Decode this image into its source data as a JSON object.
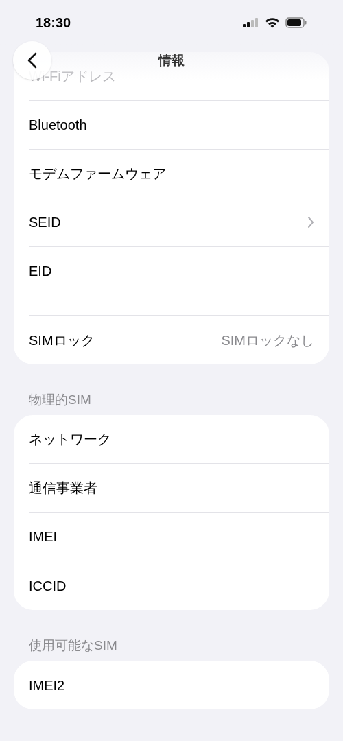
{
  "status_bar": {
    "time": "18:30"
  },
  "nav": {
    "title": "情報"
  },
  "sections": [
    {
      "rows": [
        {
          "kind": "plain",
          "label": "Wi-Fiアドレス",
          "dimmed": true
        },
        {
          "kind": "plain",
          "label": "Bluetooth",
          "dimmed": false
        },
        {
          "kind": "plain",
          "label": "モデムファームウェア",
          "dimmed": false
        },
        {
          "kind": "chevron",
          "label": "SEID",
          "dimmed": false
        },
        {
          "kind": "tall",
          "label": "EID",
          "dimmed": false
        },
        {
          "kind": "value",
          "label": "SIMロック",
          "value": "SIMロックなし",
          "dimmed": false
        }
      ]
    },
    {
      "header": "物理的SIM",
      "rows": [
        {
          "kind": "plain",
          "label": "ネットワーク",
          "dimmed": false
        },
        {
          "kind": "plain",
          "label": "通信事業者",
          "dimmed": false
        },
        {
          "kind": "plain",
          "label": "IMEI",
          "dimmed": false
        },
        {
          "kind": "plain",
          "label": "ICCID",
          "dimmed": false
        }
      ]
    },
    {
      "header": "使用可能なSIM",
      "rows": [
        {
          "kind": "plain",
          "label": "IMEI2",
          "dimmed": false
        }
      ]
    }
  ]
}
